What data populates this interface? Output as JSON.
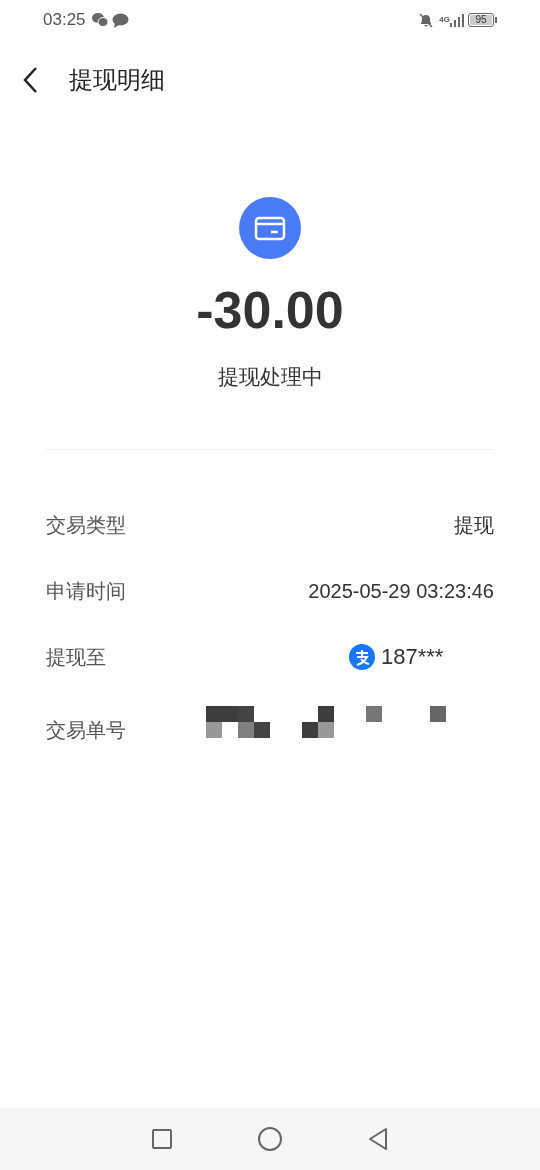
{
  "status_bar": {
    "time": "03:25",
    "network": "4G",
    "battery": "95"
  },
  "header": {
    "title": "提现明细"
  },
  "summary": {
    "amount": "-30.00",
    "status": "提现处理中"
  },
  "details": [
    {
      "kind": "text",
      "label": "交易类型",
      "value": "提现"
    },
    {
      "kind": "text",
      "label": "申请时间",
      "value": "2025-05-29 03:23:46"
    },
    {
      "kind": "account",
      "label": "提现至",
      "value": "187***"
    },
    {
      "kind": "redacted",
      "label": "交易单号"
    }
  ]
}
